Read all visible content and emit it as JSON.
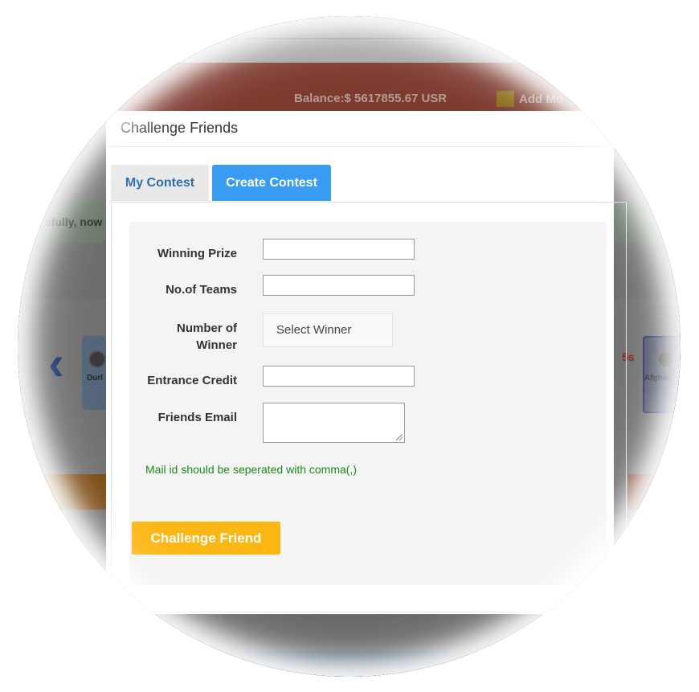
{
  "background": {
    "balance_text": "Balance:$ 5617855.67 USR",
    "add_money_label": "Add Mo",
    "success_text": "sfully, now",
    "card_left_label": "Durl",
    "card_right_label": "Afghan",
    "card_right_badge": "5s"
  },
  "modal": {
    "title": "Challenge Friends",
    "tabs": [
      {
        "label": "My Contest",
        "active": false
      },
      {
        "label": "Create Contest",
        "active": true
      }
    ],
    "form": {
      "winning_prize_label": "Winning Prize",
      "winning_prize_value": "",
      "teams_label": "No.of Teams",
      "teams_value": "",
      "winner_label": "Number of Winner",
      "winner_select_value": "Select Winner",
      "entrance_credit_label": "Entrance Credit",
      "entrance_credit_value": "",
      "friends_email_label": "Friends Email",
      "friends_email_value": "",
      "hint": "Mail id should be seperated with comma(,)",
      "submit_label": "Challenge Friend"
    }
  },
  "colors": {
    "active_tab": "#3a9bf2",
    "tab_text": "#2f6fae",
    "submit": "#fdb714",
    "hint": "#1a8a1a"
  }
}
